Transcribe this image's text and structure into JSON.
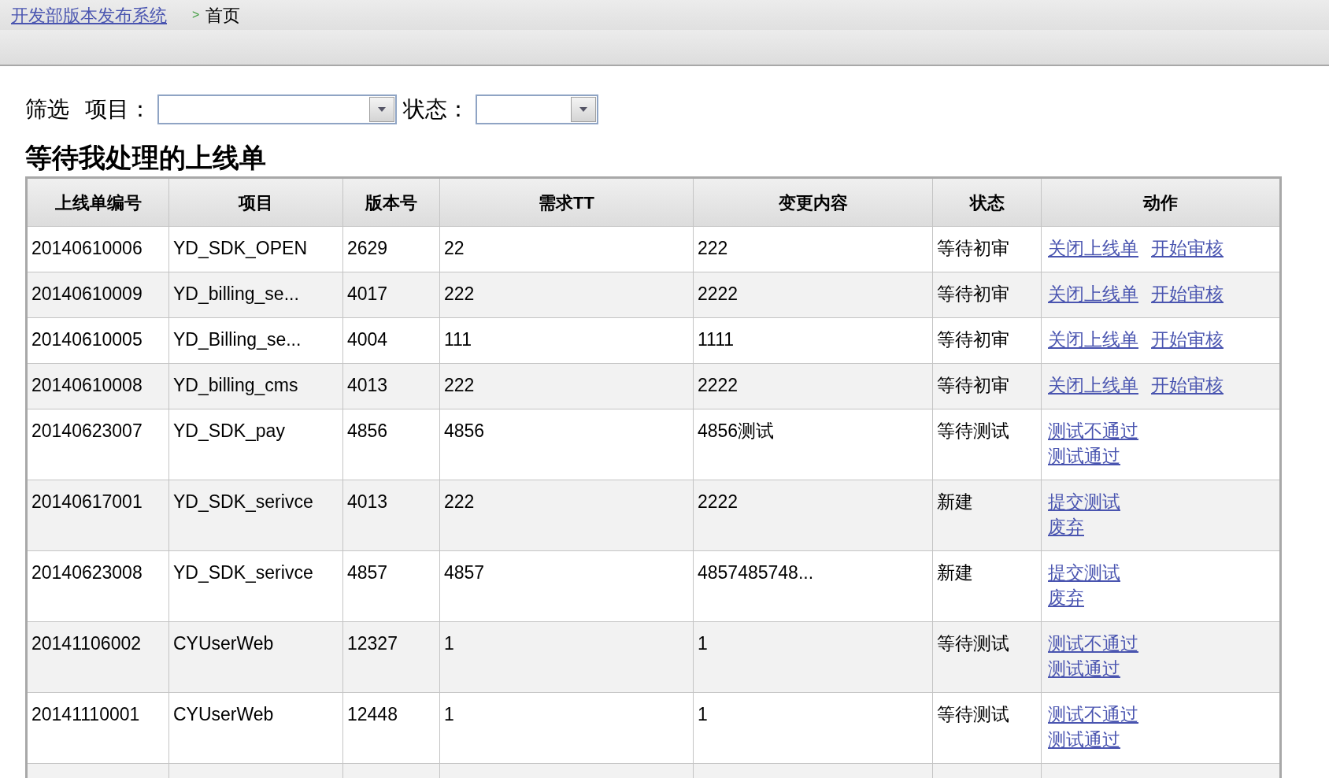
{
  "breadcrumb": {
    "home_link": "开发部版本发布系统",
    "separator": ">",
    "current": "首页"
  },
  "filters": {
    "label": "筛选",
    "fields": [
      {
        "label": "项目："
      },
      {
        "label": "状态："
      }
    ]
  },
  "section_title": "等待我处理的上线单",
  "table": {
    "columns": [
      "上线单编号",
      "项目",
      "版本号",
      "需求TT",
      "变更内容",
      "状态",
      "动作"
    ],
    "rows": [
      {
        "cells": [
          "20140610006",
          "YD_SDK_OPEN",
          "2629",
          "22",
          "222",
          "等待初审"
        ],
        "actions": [
          "关闭上线单",
          "开始审核"
        ]
      },
      {
        "cells": [
          "20140610009",
          "YD_billing_se...",
          "4017",
          "222",
          "2222",
          "等待初审"
        ],
        "actions": [
          "关闭上线单",
          "开始审核"
        ]
      },
      {
        "cells": [
          "20140610005",
          "YD_Billing_se...",
          "4004",
          "111",
          "1111",
          "等待初审"
        ],
        "actions": [
          "关闭上线单",
          "开始审核"
        ]
      },
      {
        "cells": [
          "20140610008",
          "YD_billing_cms",
          "4013",
          "222",
          "2222",
          "等待初审"
        ],
        "actions": [
          "关闭上线单",
          "开始审核"
        ]
      },
      {
        "cells": [
          "20140623007",
          "YD_SDK_pay",
          "4856",
          "4856",
          "4856测试",
          "等待测试"
        ],
        "actions": [
          "测试不通过",
          "测试通过"
        ]
      },
      {
        "cells": [
          "20140617001",
          "YD_SDK_serivce",
          "4013",
          "222",
          "2222",
          "新建"
        ],
        "actions": [
          "提交测试",
          "废弃"
        ]
      },
      {
        "cells": [
          "20140623008",
          "YD_SDK_serivce",
          "4857",
          "4857",
          "4857485748...",
          "新建"
        ],
        "actions": [
          "提交测试",
          "废弃"
        ]
      },
      {
        "cells": [
          "20141106002",
          "CYUserWeb",
          "12327",
          "1",
          "1",
          "等待测试"
        ],
        "actions": [
          "测试不通过",
          "测试通过"
        ]
      },
      {
        "cells": [
          "20141110001",
          "CYUserWeb",
          "12448",
          "1",
          "1",
          "等待测试"
        ],
        "actions": [
          "测试不通过",
          "测试通过"
        ]
      }
    ]
  }
}
